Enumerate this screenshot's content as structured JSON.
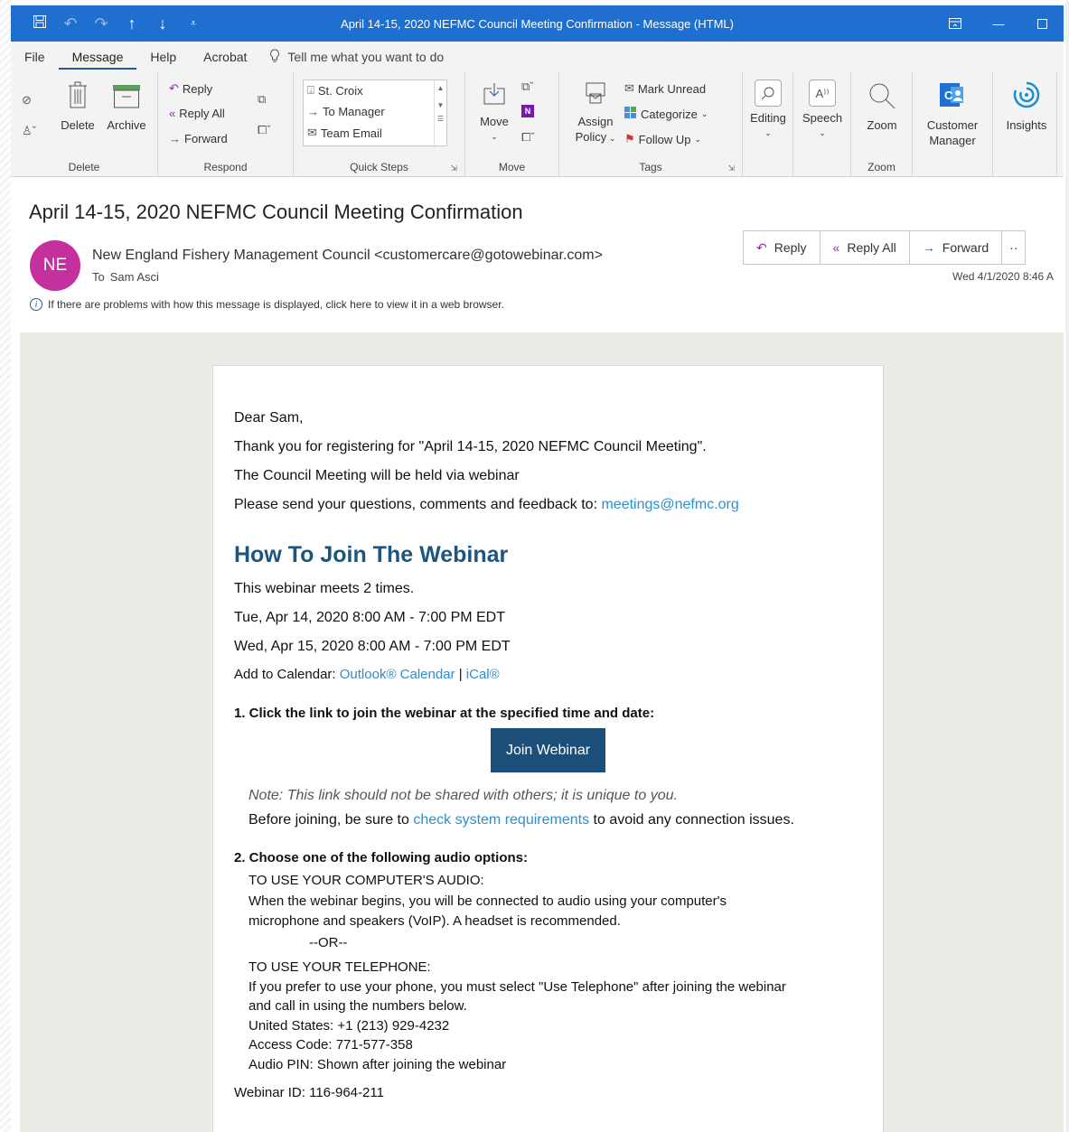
{
  "window": {
    "title": "April 14-15, 2020 NEFMC Council Meeting Confirmation  -  Message (HTML)"
  },
  "menu": {
    "file": "File",
    "message": "Message",
    "help": "Help",
    "acrobat": "Acrobat",
    "tell": "Tell me what you want to do"
  },
  "ribbon": {
    "delete_group": {
      "label": "Delete",
      "delete": "Delete",
      "archive": "Archive"
    },
    "respond_group": {
      "label": "Respond",
      "reply": "Reply",
      "reply_all": "Reply All",
      "forward": "Forward"
    },
    "quick_steps": {
      "label": "Quick Steps",
      "items": [
        "St. Croix",
        "To Manager",
        "Team Email"
      ]
    },
    "move_group": {
      "label": "Move",
      "move": "Move"
    },
    "tags_group": {
      "label": "Tags",
      "assign_policy": "Assign",
      "assign_policy2": "Policy",
      "mark_unread": "Mark Unread",
      "categorize": "Categorize",
      "follow_up": "Follow Up"
    },
    "editing": "Editing",
    "speech": "Speech",
    "zoom_group": {
      "label": "Zoom",
      "zoom": "Zoom"
    },
    "customer_manager": "Customer",
    "customer_manager2": "Manager",
    "insights": "Insights"
  },
  "message": {
    "subject": "April 14-15, 2020 NEFMC Council Meeting Confirmation",
    "avatar": "NE",
    "sender": "New England Fishery Management Council <customercare@gotowebinar.com>",
    "to_label": "To",
    "to": "Sam Asci",
    "date": "Wed 4/1/2020 8:46 A",
    "reply": "Reply",
    "reply_all": "Reply All",
    "forward": "Forward",
    "info": "If there are problems with how this message is displayed, click here to view it in a web browser."
  },
  "body": {
    "greeting": "Dear Sam,",
    "thanks": "Thank you for registering for \"April 14-15, 2020 NEFMC Council Meeting\".",
    "held": "The Council Meeting will be held via webinar",
    "send_prefix": "Please send your questions, comments and feedback to: ",
    "email": "meetings@nefmc.org",
    "heading": "How To Join The Webinar",
    "meets": "This webinar meets 2 times.",
    "date1": "Tue, Apr 14, 2020 8:00 AM - 7:00 PM EDT",
    "date2": "Wed, Apr 15, 2020 8:00 AM - 7:00 PM EDT",
    "cal_prefix": "Add to Calendar: ",
    "cal_outlook": "Outlook® Calendar",
    "cal_sep": " | ",
    "cal_ical": "iCal®",
    "step1": "1. Click the link to join the webinar at the specified time and date:",
    "join": "Join Webinar",
    "note": "Note: This link should not be shared with others; it is unique to you.",
    "before_prefix": "Before joining, be sure to ",
    "before_link": "check system requirements",
    "before_suffix": " to avoid any connection issues.",
    "step2": "2. Choose one of the following audio options:",
    "comp_audio": "TO USE YOUR COMPUTER'S AUDIO:",
    "comp_line1": "When the webinar begins, you will be connected to audio using your computer's",
    "comp_line2": "microphone and speakers (VoIP). A headset is recommended.",
    "or": "--OR--",
    "tel": "TO USE YOUR TELEPHONE:",
    "tel_line1": "If you prefer to use your phone, you must select \"Use Telephone\" after joining the webinar",
    "tel_line2": "and call in using the numbers below.",
    "us": "United States: +1 (213) 929-4232",
    "access": "Access Code: 771-577-358",
    "pin": "Audio PIN: Shown after joining the webinar",
    "webinar_id": "Webinar ID: 116-964-211"
  }
}
